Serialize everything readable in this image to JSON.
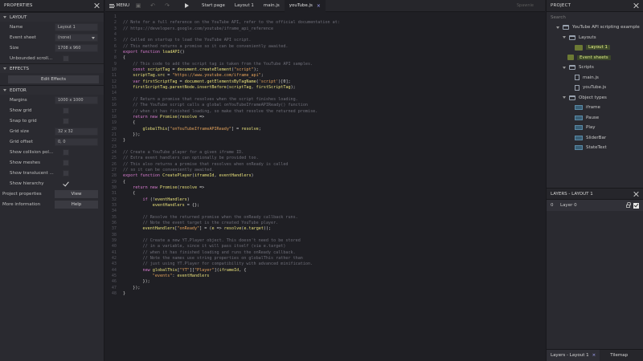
{
  "properties": {
    "title": "PROPERTIES",
    "layout": {
      "section": "LAYOUT",
      "name_label": "Name",
      "name_value": "Layout 1",
      "event_sheet_label": "Event sheet",
      "event_sheet_value": "(none)",
      "size_label": "Size",
      "size_value": "1708 x 960",
      "unbounded_label": "Unbounded scroll..."
    },
    "effects": {
      "section": "EFFECTS",
      "edit_button": "Edit Effects"
    },
    "editor": {
      "section": "EDITOR",
      "margins_label": "Margins",
      "margins_value": "1000 x 1000",
      "show_grid": "Show grid",
      "snap_grid": "Snap to grid",
      "grid_size_label": "Grid size",
      "grid_size_value": "32 x 32",
      "grid_offset_label": "Grid offset",
      "grid_offset_value": "0, 0",
      "show_collision": "Show collision pol...",
      "show_meshes": "Show meshes",
      "show_translucent": "Show translucent ...",
      "show_hierarchy": "Show hierarchy",
      "show_hierarchy_checked": true
    },
    "project_props_label": "Project properties",
    "view_button": "View",
    "more_info_label": "More information",
    "help_button": "Help"
  },
  "toolbar": {
    "menu_label": "MENU",
    "tabs": [
      "Start page",
      "Layout 1",
      "main.js",
      "youTube.js"
    ],
    "active_tab": "youTube.js",
    "spawn_label": "Spawnie"
  },
  "code_lines": [
    [],
    [
      [
        "c",
        "// Note for a full reference on the YouTube API, refer to the official documentation at:"
      ]
    ],
    [
      [
        "c",
        "// https://developers.google.com/youtube/iframe_api_reference"
      ]
    ],
    [],
    [
      [
        "c",
        "// Called on startup to load the YouTube API script."
      ]
    ],
    [
      [
        "c",
        "// This method returns a promise so it can be conveniently awaited."
      ]
    ],
    [
      [
        "k",
        "export function "
      ],
      [
        "v",
        "loadAPI"
      ],
      [
        "p",
        "()"
      ]
    ],
    [
      [
        "p",
        "{"
      ]
    ],
    [
      [
        "c",
        "    // This code to add the script tag is taken from the YouTube API samples."
      ]
    ],
    [
      [
        "k",
        "    const "
      ],
      [
        "v",
        "scriptTag"
      ],
      [
        "p",
        " = "
      ],
      [
        "v",
        "document"
      ],
      [
        "p",
        "."
      ],
      [
        "v",
        "createElement"
      ],
      [
        "p",
        "("
      ],
      [
        "s",
        "\"script\""
      ],
      [
        "p",
        ");"
      ]
    ],
    [
      [
        "v",
        "    scriptTag"
      ],
      [
        "p",
        "."
      ],
      [
        "v",
        "src"
      ],
      [
        "p",
        " = "
      ],
      [
        "s",
        "\"https://www.youtube.com/iframe_api\""
      ],
      [
        "p",
        ";"
      ]
    ],
    [
      [
        "k",
        "    var "
      ],
      [
        "v",
        "firstScriptTag"
      ],
      [
        "p",
        " = "
      ],
      [
        "v",
        "document"
      ],
      [
        "p",
        "."
      ],
      [
        "v",
        "getElementsByTagName"
      ],
      [
        "p",
        "("
      ],
      [
        "s",
        "'script'"
      ],
      [
        "p",
        ")[0];"
      ]
    ],
    [
      [
        "v",
        "    firstScriptTag"
      ],
      [
        "p",
        "."
      ],
      [
        "v",
        "parentNode"
      ],
      [
        "p",
        "."
      ],
      [
        "v",
        "insertBefore"
      ],
      [
        "p",
        "("
      ],
      [
        "v",
        "scriptTag"
      ],
      [
        "p",
        ", "
      ],
      [
        "v",
        "firstScriptTag"
      ],
      [
        "p",
        ");"
      ]
    ],
    [],
    [
      [
        "c",
        "    // Return a promise that resolves when the script finishes loading."
      ]
    ],
    [
      [
        "c",
        "    // The YouTube script calls a global onYouTubeIframeAPIReady() function"
      ]
    ],
    [
      [
        "c",
        "    // when it has finished loading, so make that resolve the returned promise."
      ]
    ],
    [
      [
        "k",
        "    return new "
      ],
      [
        "v",
        "Promise"
      ],
      [
        "p",
        "("
      ],
      [
        "v",
        "resolve"
      ],
      [
        "p",
        " =>"
      ]
    ],
    [
      [
        "p",
        "    {"
      ]
    ],
    [
      [
        "v",
        "        globalThis"
      ],
      [
        "p",
        "["
      ],
      [
        "s",
        "\"onYouTubeIframeAPIReady\""
      ],
      [
        "p",
        "] = "
      ],
      [
        "v",
        "resolve"
      ],
      [
        "p",
        ";"
      ]
    ],
    [
      [
        "p",
        "    });"
      ]
    ],
    [
      [
        "p",
        "}"
      ]
    ],
    [],
    [
      [
        "c",
        "// Create a YouTube player for a given iframe ID."
      ]
    ],
    [
      [
        "c",
        "// Extra event handlers can optionally be provided too."
      ]
    ],
    [
      [
        "c",
        "// This also returns a promise that resolves when onReady is called"
      ]
    ],
    [
      [
        "c",
        "// so it can be conveniently awaited."
      ]
    ],
    [
      [
        "k",
        "export function "
      ],
      [
        "v",
        "CreatePlayer"
      ],
      [
        "p",
        "("
      ],
      [
        "v",
        "iframeId"
      ],
      [
        "p",
        ", "
      ],
      [
        "v",
        "eventHandlers"
      ],
      [
        "p",
        ")"
      ]
    ],
    [
      [
        "p",
        "{"
      ]
    ],
    [
      [
        "k",
        "    return new "
      ],
      [
        "v",
        "Promise"
      ],
      [
        "p",
        "("
      ],
      [
        "v",
        "resolve"
      ],
      [
        "p",
        " =>"
      ]
    ],
    [
      [
        "p",
        "    {"
      ]
    ],
    [
      [
        "k",
        "        if "
      ],
      [
        "p",
        "(!"
      ],
      [
        "v",
        "eventHandlers"
      ],
      [
        "p",
        ")"
      ]
    ],
    [
      [
        "v",
        "            eventHandlers"
      ],
      [
        "p",
        " = {};"
      ]
    ],
    [],
    [
      [
        "c",
        "        // Resolve the returned promise when the onReady callback runs."
      ]
    ],
    [
      [
        "c",
        "        // Note the event target is the created YouTube player."
      ]
    ],
    [
      [
        "v",
        "        eventHandlers"
      ],
      [
        "p",
        "["
      ],
      [
        "s",
        "\"onReady\""
      ],
      [
        "p",
        "] = ("
      ],
      [
        "v",
        "e"
      ],
      [
        "p",
        " => "
      ],
      [
        "v",
        "resolve"
      ],
      [
        "p",
        "("
      ],
      [
        "v",
        "e"
      ],
      [
        "p",
        "."
      ],
      [
        "v",
        "target"
      ],
      [
        "p",
        "));"
      ]
    ],
    [],
    [
      [
        "c",
        "        // Create a new YT.Player object. This doesn't need to be stored"
      ]
    ],
    [
      [
        "c",
        "        // in a variable, since it will pass itself (via e.target)"
      ]
    ],
    [
      [
        "c",
        "        // when it has finished loading and runs the onReady callback."
      ]
    ],
    [
      [
        "c",
        "        // Note the names use string properties on globalThis rather than"
      ]
    ],
    [
      [
        "c",
        "        // just using YT.Player for compatibility with advanced minification."
      ]
    ],
    [
      [
        "k",
        "        new "
      ],
      [
        "v",
        "globalThis"
      ],
      [
        "p",
        "["
      ],
      [
        "s",
        "\"YT\""
      ],
      [
        "p",
        "]["
      ],
      [
        "s",
        "\"Player\""
      ],
      [
        "p",
        "]("
      ],
      [
        "v",
        "iframeId"
      ],
      [
        "p",
        ", {"
      ]
    ],
    [
      [
        "s",
        "            \"events\""
      ],
      [
        "p",
        ": "
      ],
      [
        "v",
        "eventHandlers"
      ]
    ],
    [
      [
        "p",
        "        });"
      ]
    ],
    [
      [
        "p",
        "    });"
      ]
    ],
    [
      [
        "p",
        "}"
      ]
    ]
  ],
  "project": {
    "title": "PROJECT",
    "search_placeholder": "Search",
    "root": "YouTube API scripting example",
    "layouts_folder": "Layouts",
    "layout_item": "Layout 1",
    "event_sheets_folder": "Event sheets",
    "scripts_folder": "Scripts",
    "scripts": [
      "main.js",
      "youTube.js"
    ],
    "object_types_folder": "Object types",
    "object_types": [
      "iframe",
      "Pause",
      "Play",
      "SliderBar",
      "StateText"
    ]
  },
  "layers": {
    "title": "LAYERS - LAYOUT 1",
    "rows": [
      {
        "index": "0",
        "name": "Layer 0"
      }
    ]
  },
  "bottom_tabs": {
    "layers_tab": "Layers - Layout 1",
    "tilemap_tab": "Tilemap"
  },
  "colors": {
    "comment": "#6e6e78",
    "keyword": "#d77ccf",
    "string": "#e4a25a",
    "identifier": "#e8e07a",
    "highlight": "#e9ef8a"
  }
}
